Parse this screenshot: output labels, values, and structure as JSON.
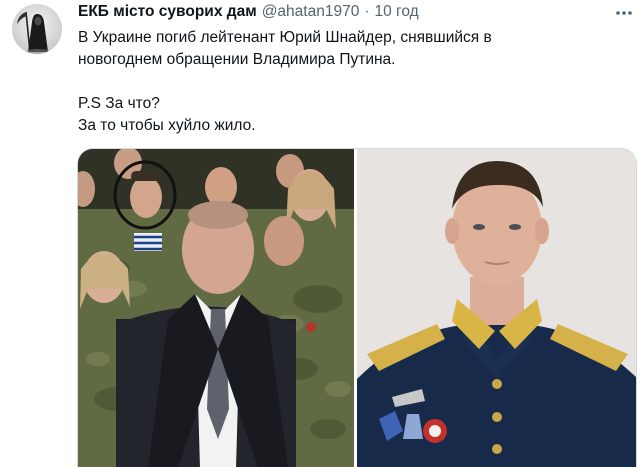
{
  "tweet": {
    "display_name": "ЕКБ місто суворих дам",
    "handle": "@ahatan1970",
    "separator": "·",
    "time": "10 год",
    "text_lines": [
      "В Украине погиб лейтенант Юрий Шнайдер, снявшийся в",
      "новогоднем обращении Владимира Путина."
    ],
    "ps_lines": [
      "P.S За что?",
      "За то чтобы хуйло жило."
    ]
  },
  "icons": {
    "avatar": "grim-reaper-avatar",
    "more": "more-options-icon"
  },
  "colors": {
    "text": "#0f1419",
    "secondary": "#536471",
    "border": "#cfd9de"
  }
}
